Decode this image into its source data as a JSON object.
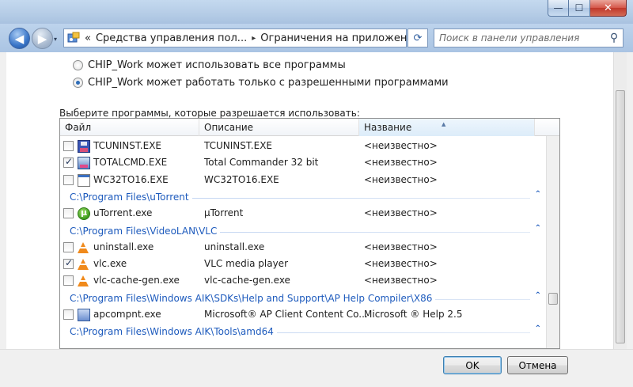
{
  "window": {
    "minimize": "—",
    "maximize": "☐",
    "close": "✕"
  },
  "toolbar": {
    "back": "◀",
    "forward": "▶",
    "nav_dropdown": "▾",
    "breadcrumb_start": "«",
    "breadcrumb": [
      "Средства управления пол...",
      "Ограничения на приложения"
    ],
    "breadcrumb_sep": "▸",
    "address_dropdown": "▾",
    "refresh": "⟳",
    "search_placeholder": "Поиск в панели управления",
    "search_icon": "⚲"
  },
  "options": {
    "radio_all": "CHIP_Work может использовать все программы",
    "radio_allowed": "CHIP_Work может работать только с разрешенными программами",
    "selected": "radio_allowed"
  },
  "list": {
    "label": "Выберите программы, которые разрешается использовать:",
    "columns": {
      "file": "Файл",
      "description": "Описание",
      "name": "Название"
    },
    "sort_indicator": "▲",
    "collapse_glyph": "⌃",
    "rows": [
      {
        "type": "item",
        "icon": "floppy-icon",
        "checked": false,
        "file": "TCUNINST.EXE",
        "desc": "TCUNINST.EXE",
        "name": "<неизвестно>"
      },
      {
        "type": "item",
        "icon": "total-commander-icon",
        "checked": true,
        "file": "TOTALCMD.EXE",
        "desc": "Total Commander 32 bit",
        "name": "<неизвестно>"
      },
      {
        "type": "item",
        "icon": "window-icon",
        "checked": false,
        "file": "WC32TO16.EXE",
        "desc": "WC32TO16.EXE",
        "name": "<неизвестно>"
      },
      {
        "type": "group",
        "path": "C:\\Program Files\\uTorrent"
      },
      {
        "type": "item",
        "icon": "utorrent-icon",
        "checked": false,
        "file": "uTorrent.exe",
        "desc": "µTorrent",
        "name": "<неизвестно>"
      },
      {
        "type": "group",
        "path": "C:\\Program Files\\VideoLAN\\VLC"
      },
      {
        "type": "item",
        "icon": "vlc-icon",
        "checked": false,
        "file": "uninstall.exe",
        "desc": "uninstall.exe",
        "name": "<неизвестно>"
      },
      {
        "type": "item",
        "icon": "vlc-icon",
        "checked": true,
        "file": "vlc.exe",
        "desc": "VLC media player",
        "name": "<неизвестно>"
      },
      {
        "type": "item",
        "icon": "vlc-icon",
        "checked": false,
        "file": "vlc-cache-gen.exe",
        "desc": "vlc-cache-gen.exe",
        "name": "<неизвестно>"
      },
      {
        "type": "group",
        "path": "C:\\Program Files\\Windows AIK\\SDKs\\Help and Support\\AP Help Compiler\\X86"
      },
      {
        "type": "item",
        "icon": "help-compiler-icon",
        "checked": false,
        "file": "apcompnt.exe",
        "desc": "Microsoft® AP Client Content Co...",
        "name": "Microsoft ® Help 2.5"
      },
      {
        "type": "group",
        "path": "C:\\Program Files\\Windows AIK\\Tools\\amd64"
      }
    ]
  },
  "footer": {
    "ok_label": "OK",
    "cancel_label": "Отмена"
  }
}
